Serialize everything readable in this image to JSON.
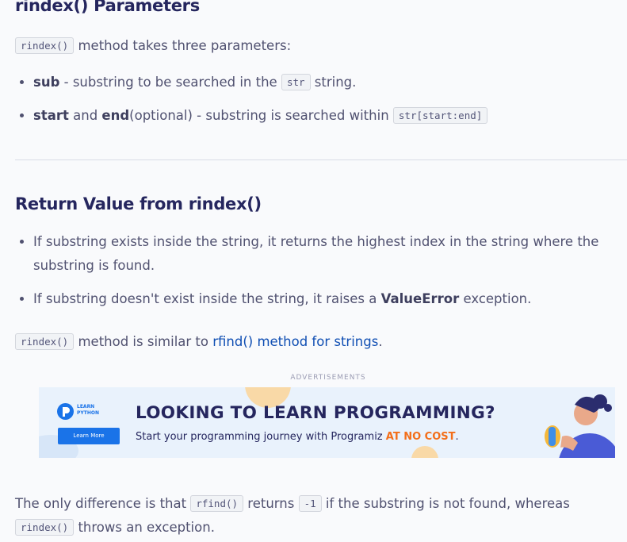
{
  "section1": {
    "heading": "rindex() Parameters",
    "intro_code": "rindex()",
    "intro_text": "method takes three parameters:",
    "params": [
      {
        "name": "sub",
        "text_before": " - substring to be searched in the ",
        "code": "str",
        "text_after": " string."
      },
      {
        "name1": "start",
        "joiner": " and ",
        "name2": "end",
        "text": "(optional) - substring is searched within ",
        "code": "str[start:end]"
      }
    ]
  },
  "section2": {
    "heading": "Return Value from rindex()",
    "items": [
      {
        "text": "If substring exists inside the string, it returns the highest index in the string where the substring is found."
      },
      {
        "text_before": "If substring doesn't exist inside the string, it raises a ",
        "bold": "ValueError",
        "text_after": " exception."
      }
    ],
    "similar": {
      "code": "rindex()",
      "text": " method is similar to ",
      "link": "rfind() method for strings",
      "end": "."
    }
  },
  "ad": {
    "label": "ADVERTISEMENTS",
    "logo_line1": "LEARN",
    "logo_line2": "PYTHON",
    "button": "Learn More",
    "title": "LOOKING TO LEARN PROGRAMMING?",
    "subtitle": "Start your programming journey with Programiz ",
    "subtitle_accent": "AT NO COST",
    "subtitle_end": "."
  },
  "closing": {
    "t1": "The only difference is that ",
    "c1": "rfind()",
    "t2": " returns ",
    "c2": "-1",
    "t3": " if the substring is not found, whereas ",
    "c3": "rindex()",
    "t4": " throws an exception."
  },
  "colors": {
    "heading": "#25265e",
    "body_text": "#505170",
    "link": "#0f4eb3",
    "accent_orange": "#f36e19",
    "brand_blue": "#1a73e8"
  }
}
